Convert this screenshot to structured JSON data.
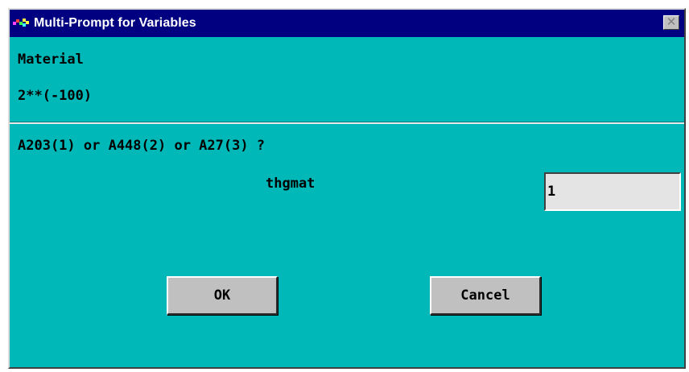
{
  "window": {
    "title": "Multi-Prompt for Variables",
    "close_glyph": "✕",
    "colors": {
      "titlebar": "#000080",
      "background": "#00b8b8",
      "button": "#c0c0c0"
    }
  },
  "header": {
    "line1": "Material",
    "line2": "2**(-100)"
  },
  "prompt": {
    "question": "A203(1) or A448(2) or A27(3) ?",
    "variable_label": "thgmat",
    "value": "1"
  },
  "buttons": {
    "ok_label": "OK",
    "cancel_label": "Cancel"
  }
}
